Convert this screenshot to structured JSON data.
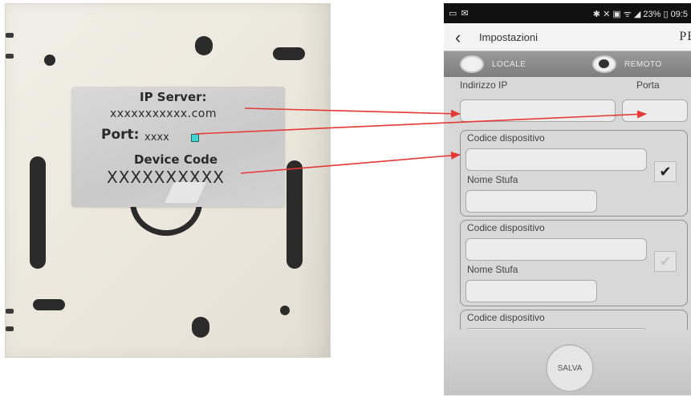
{
  "device_label": {
    "ip_server_title": "IP Server:",
    "ip_server_value": "xxxxxxxxxxx.com",
    "port_title": "Port:",
    "port_value": "xxxx",
    "device_code_title": "Device Code",
    "device_code_value": "XXXXXXXXXX"
  },
  "phone": {
    "statusbar": {
      "left_icons": "▭ ✉",
      "right": "✱ ✕ ▣ ᯤ ◢ 23% ▯ 09:5"
    },
    "navbar": {
      "back_label": "‹",
      "title": "Impostazioni",
      "brand": "PE"
    },
    "modes": {
      "locale_label": "LOCALE",
      "remoto_label": "REMOTO",
      "selected": "REMOTO"
    },
    "fields": {
      "ip_label": "Indirizzo IP",
      "ip_value": "",
      "porta_label": "Porta",
      "porta_value": ""
    },
    "devices": [
      {
        "code_label": "Codice dispositivo",
        "code_value": "",
        "name_label": "Nome Stufa",
        "name_value": "",
        "checked": true
      },
      {
        "code_label": "Codice dispositivo",
        "code_value": "",
        "name_label": "Nome Stufa",
        "name_value": "",
        "checked": false
      },
      {
        "code_label": "Codice dispositivo",
        "code_value": ""
      }
    ],
    "save_label": "SALVA"
  },
  "colors": {
    "arrow": "#e53935",
    "label_bg": "#cfcfcf",
    "plate_bg": "#ede9df",
    "indicator": "#3fd6d2"
  }
}
